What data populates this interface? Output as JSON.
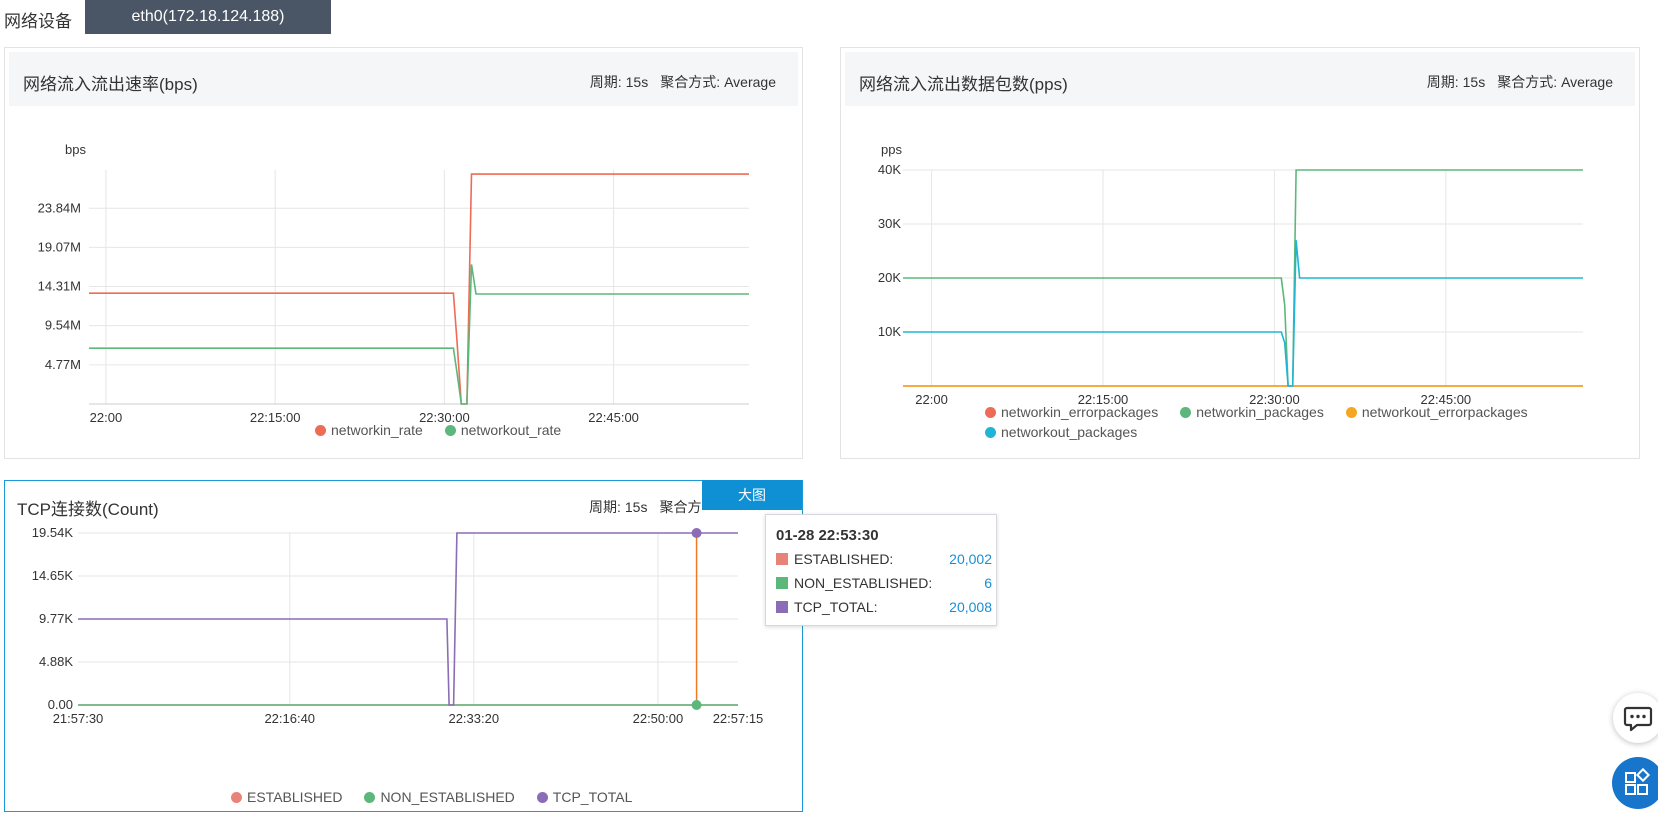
{
  "header": {
    "label": "网络设备",
    "device_tab": "eth0(172.18.124.188)"
  },
  "panels": [
    {
      "title": "网络流入流出速率(bps)",
      "period_label": "周期:",
      "period": "15s",
      "agg_label": "聚合方式:",
      "agg": "Average"
    },
    {
      "title": "网络流入流出数据包数(pps)",
      "period_label": "周期:",
      "period": "15s",
      "agg_label": "聚合方式:",
      "agg": "Average"
    },
    {
      "title": "TCP连接数(Count)",
      "period_label": "周期:",
      "period": "15s",
      "agg_label": "聚合方",
      "big_button": "大图"
    }
  ],
  "tooltip": {
    "time": "01-28 22:53:30",
    "rows": [
      {
        "name": "ESTABLISHED:",
        "value": "20,002",
        "color": "#e8837a"
      },
      {
        "name": "NON_ESTABLISHED:",
        "value": "6",
        "color": "#5cb87a"
      },
      {
        "name": "TCP_TOTAL:",
        "value": "20,008",
        "color": "#8b6db5"
      }
    ]
  },
  "icons": {
    "chat": "chat-icon",
    "apps": "apps-icon"
  },
  "chart_data": [
    {
      "type": "line",
      "ylabel": "bps",
      "yticks": [
        "4.77M",
        "9.54M",
        "14.31M",
        "19.07M",
        "23.84M"
      ],
      "ytick_values": [
        4.77,
        9.54,
        14.31,
        19.07,
        23.84
      ],
      "xticks": [
        "22:00",
        "22:15:00",
        "22:30:00",
        "22:45:00"
      ],
      "xtick_minutes": [
        0,
        15,
        30,
        45
      ],
      "xlim": [
        -1.5,
        57
      ],
      "ylim": [
        0,
        28.5
      ],
      "grid": true,
      "legend": "bottom",
      "series": [
        {
          "name": "networkin_rate",
          "color": "#ee6b55",
          "x": [
            -1.5,
            30.8,
            31.1,
            31.5,
            32.0,
            32.4,
            57
          ],
          "y": [
            13.5,
            13.5,
            8.0,
            0,
            0,
            28.0,
            28.0
          ]
        },
        {
          "name": "networkout_rate",
          "color": "#5cb87a",
          "x": [
            -1.5,
            30.8,
            31.1,
            31.5,
            32.0,
            32.4,
            32.8,
            57
          ],
          "y": [
            6.8,
            6.8,
            4.0,
            0,
            0,
            17.0,
            13.4,
            13.4
          ]
        }
      ]
    },
    {
      "type": "line",
      "ylabel": "pps",
      "yticks": [
        "10K",
        "20K",
        "30K",
        "40K"
      ],
      "ytick_values": [
        10000,
        20000,
        30000,
        40000
      ],
      "xticks": [
        "22:00",
        "22:15:00",
        "22:30:00",
        "22:45:00"
      ],
      "xtick_minutes": [
        0,
        15,
        30,
        45
      ],
      "xlim": [
        -2.5,
        57
      ],
      "ylim": [
        0,
        40000
      ],
      "grid": true,
      "legend": "bottom",
      "series": [
        {
          "name": "networkin_errorpackages",
          "color": "#ee6b55",
          "x": [
            -2.5,
            57
          ],
          "y": [
            0,
            0
          ]
        },
        {
          "name": "networkin_packages",
          "color": "#5cb87a",
          "x": [
            -2.5,
            30.6,
            30.9,
            31.2,
            31.6,
            31.9,
            57
          ],
          "y": [
            20000,
            20000,
            15000,
            0,
            0,
            40000,
            40000
          ]
        },
        {
          "name": "networkout_errorpackages",
          "color": "#f5a623",
          "x": [
            -2.5,
            57
          ],
          "y": [
            0,
            0
          ]
        },
        {
          "name": "networkout_packages",
          "color": "#1fb5d6",
          "x": [
            -2.5,
            30.6,
            30.9,
            31.2,
            31.6,
            31.9,
            32.2,
            57
          ],
          "y": [
            10000,
            10000,
            8000,
            0,
            0,
            27000,
            20000,
            20000
          ]
        }
      ]
    },
    {
      "type": "line",
      "yticks": [
        "0.00",
        "4.88K",
        "9.77K",
        "14.65K",
        "19.54K"
      ],
      "ytick_values": [
        0,
        4880,
        9770,
        14650,
        19540
      ],
      "xticks": [
        "21:57:30",
        "22:16:40",
        "22:33:20",
        "22:50:00",
        "22:57:15"
      ],
      "xtick_minutes": [
        0,
        19.17,
        35.83,
        52.5,
        59.75
      ],
      "xlim": [
        0,
        59.75
      ],
      "ylim": [
        0,
        19540
      ],
      "grid": true,
      "legend": "bottom",
      "cursor_minute": 56.0,
      "series": [
        {
          "name": "ESTABLISHED",
          "color": "#e8837a",
          "x": [
            0,
            59.75
          ],
          "y": [
            0,
            0
          ]
        },
        {
          "name": "NON_ESTABLISHED",
          "color": "#5cb87a",
          "x": [
            0,
            59.75
          ],
          "y": [
            0,
            0
          ]
        },
        {
          "name": "TCP_TOTAL",
          "color": "#8b6db5",
          "x": [
            0,
            33.4,
            33.6,
            34.0,
            34.3,
            59.75
          ],
          "y": [
            9770,
            9770,
            0,
            0,
            19540,
            19540
          ]
        }
      ]
    }
  ]
}
